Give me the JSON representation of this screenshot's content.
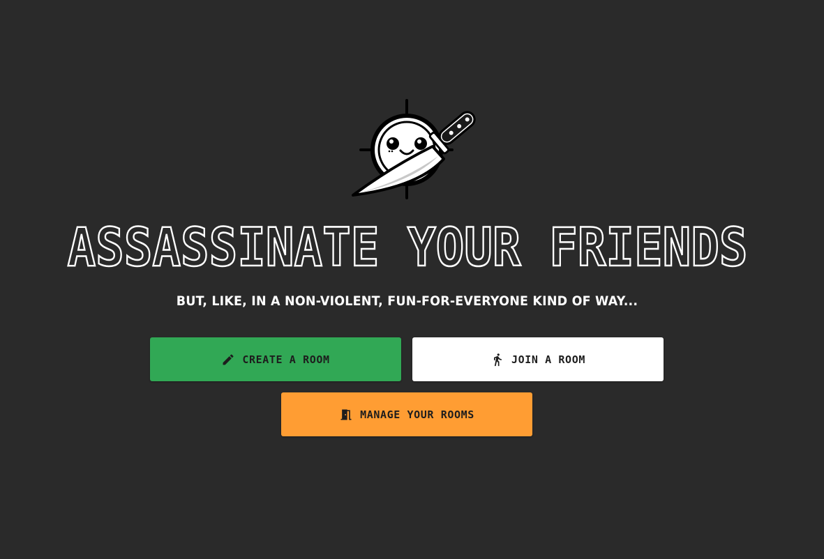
{
  "hero": {
    "title": "ASSASSINATE YOUR FRIENDS",
    "subtitle": "BUT, LIKE, IN A NON-VIOLENT, FUN-FOR-EVERYONE KIND OF WAY..."
  },
  "actions": {
    "create": {
      "label": "CREATE A ROOM",
      "icon": "pencil-icon",
      "color": "#31a855"
    },
    "join": {
      "label": "JOIN A ROOM",
      "icon": "walking-person-icon",
      "color": "#ffffff"
    },
    "manage": {
      "label": "MANAGE YOUR ROOMS",
      "icon": "door-icon",
      "color": "#ff9d33"
    }
  },
  "theme": {
    "background": "#2a2a2a",
    "text": "#ffffff"
  }
}
